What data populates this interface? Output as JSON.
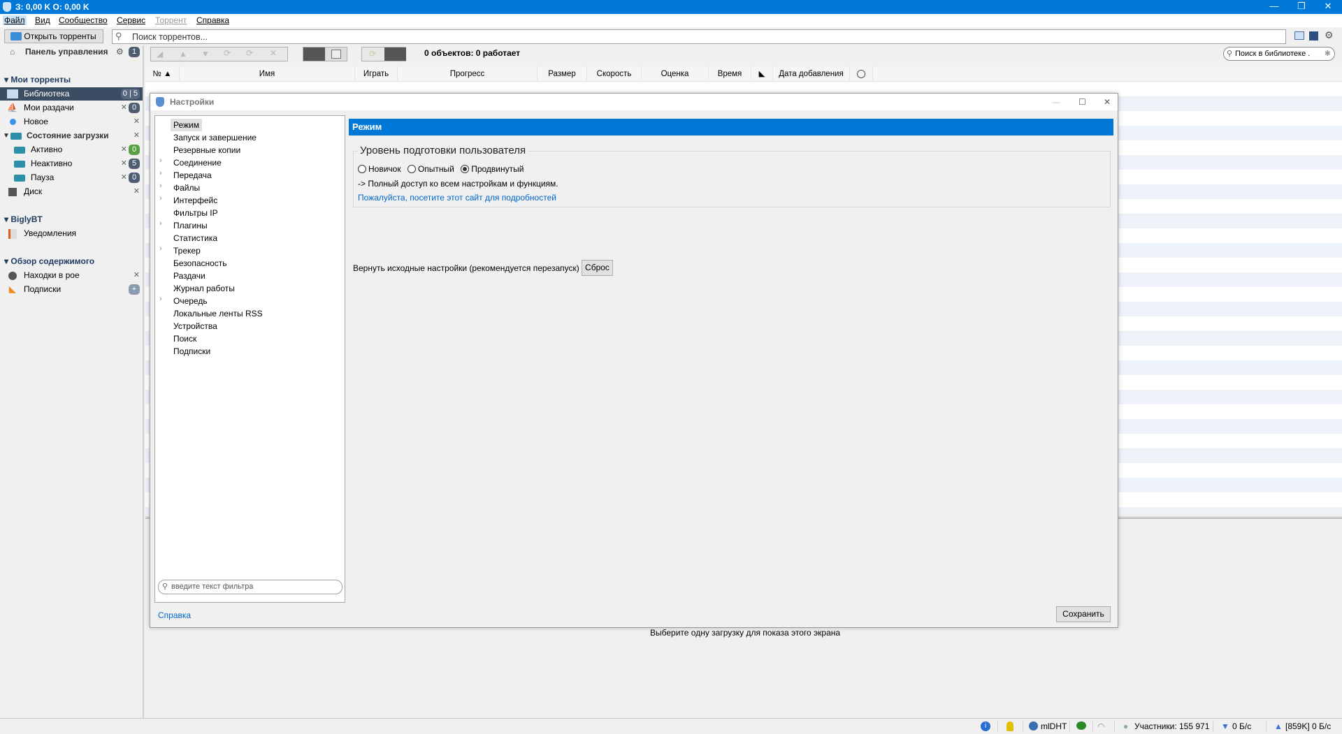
{
  "window": {
    "title": "З: 0,00 K O: 0,00 K"
  },
  "menu": [
    "Файл",
    "Вид",
    "Сообщество",
    "Сервис",
    "Торрент",
    "Справка"
  ],
  "toolbar": {
    "open_label": "Открыть торренты",
    "search_placeholder": "Поиск торрентов..."
  },
  "sidebar": {
    "dashboard": {
      "label": "Панель управления",
      "badge": "1"
    },
    "sections": [
      {
        "title": "Мои торренты"
      },
      {
        "title": "BiglyBT"
      },
      {
        "title": "Обзор содержимого"
      }
    ],
    "items": [
      {
        "label": "Библиотека",
        "badge": "0 | 5"
      },
      {
        "label": "Мои раздачи",
        "badge": "0"
      },
      {
        "label": "Новое"
      },
      {
        "label": "Состояние загрузки"
      },
      {
        "label": "Активно",
        "badge": "0"
      },
      {
        "label": "Неактивно",
        "badge": "5"
      },
      {
        "label": "Пауза",
        "badge": "0"
      },
      {
        "label": "Диск"
      },
      {
        "label": "Уведомления"
      },
      {
        "label": "Находки в рое"
      },
      {
        "label": "Подписки"
      }
    ],
    "colors": {
      "selected": "#3b4d63",
      "badge": "#4e5d72",
      "badge_active": "#5aa043"
    }
  },
  "library": {
    "status": "0 объектов: 0 работает",
    "search_placeholder": "Поиск в библиотеке .",
    "columns": [
      "№",
      "Имя",
      "Играть",
      "Прогресс",
      "Размер",
      "Скорость",
      "Оценка",
      "Время",
      "",
      "Дата добавления",
      ""
    ],
    "empty_hint": "Выберите одну загрузку для показа этого экрана"
  },
  "settings": {
    "title": "Настройки",
    "tree": [
      {
        "label": "Режим",
        "expandable": false
      },
      {
        "label": "Запуск и завершение",
        "expandable": false
      },
      {
        "label": "Резервные копии",
        "expandable": false
      },
      {
        "label": "Соединение",
        "expandable": true
      },
      {
        "label": "Передача",
        "expandable": true
      },
      {
        "label": "Файлы",
        "expandable": true
      },
      {
        "label": "Интерфейс",
        "expandable": true
      },
      {
        "label": "Фильтры IP",
        "expandable": false
      },
      {
        "label": "Плагины",
        "expandable": true
      },
      {
        "label": "Статистика",
        "expandable": false
      },
      {
        "label": "Трекер",
        "expandable": true
      },
      {
        "label": "Безопасность",
        "expandable": false
      },
      {
        "label": "Раздачи",
        "expandable": false
      },
      {
        "label": "Журнал работы",
        "expandable": false
      },
      {
        "label": "Очередь",
        "expandable": true
      },
      {
        "label": "Локальные ленты RSS",
        "expandable": false
      },
      {
        "label": "Устройства",
        "expandable": false
      },
      {
        "label": "Поиск",
        "expandable": false
      },
      {
        "label": "Подписки",
        "expandable": false
      }
    ],
    "filter_placeholder": "введите текст фильтра",
    "panel_title": "Режим",
    "group_title": "Уровень подготовки пользователя",
    "levels": [
      "Новичок",
      "Опытный",
      "Продвинутый"
    ],
    "selected_level": "Продвинутый",
    "level_desc": "-> Полный доступ ко всем настройкам и функциям.",
    "link": "Пожалуйста, посетите этот сайт для подробностей",
    "reset_label": "Вернуть исходные настройки (рекомендуется перезапуск)",
    "reset_button": "Сброс",
    "help_link": "Справка",
    "save_button": "Сохранить"
  },
  "statusbar": {
    "dht": "mlDHT",
    "peers": "Участники: 155 971",
    "down": "0 Б/с",
    "up": "[859K] 0 Б/с"
  },
  "accent": "#0078d7"
}
